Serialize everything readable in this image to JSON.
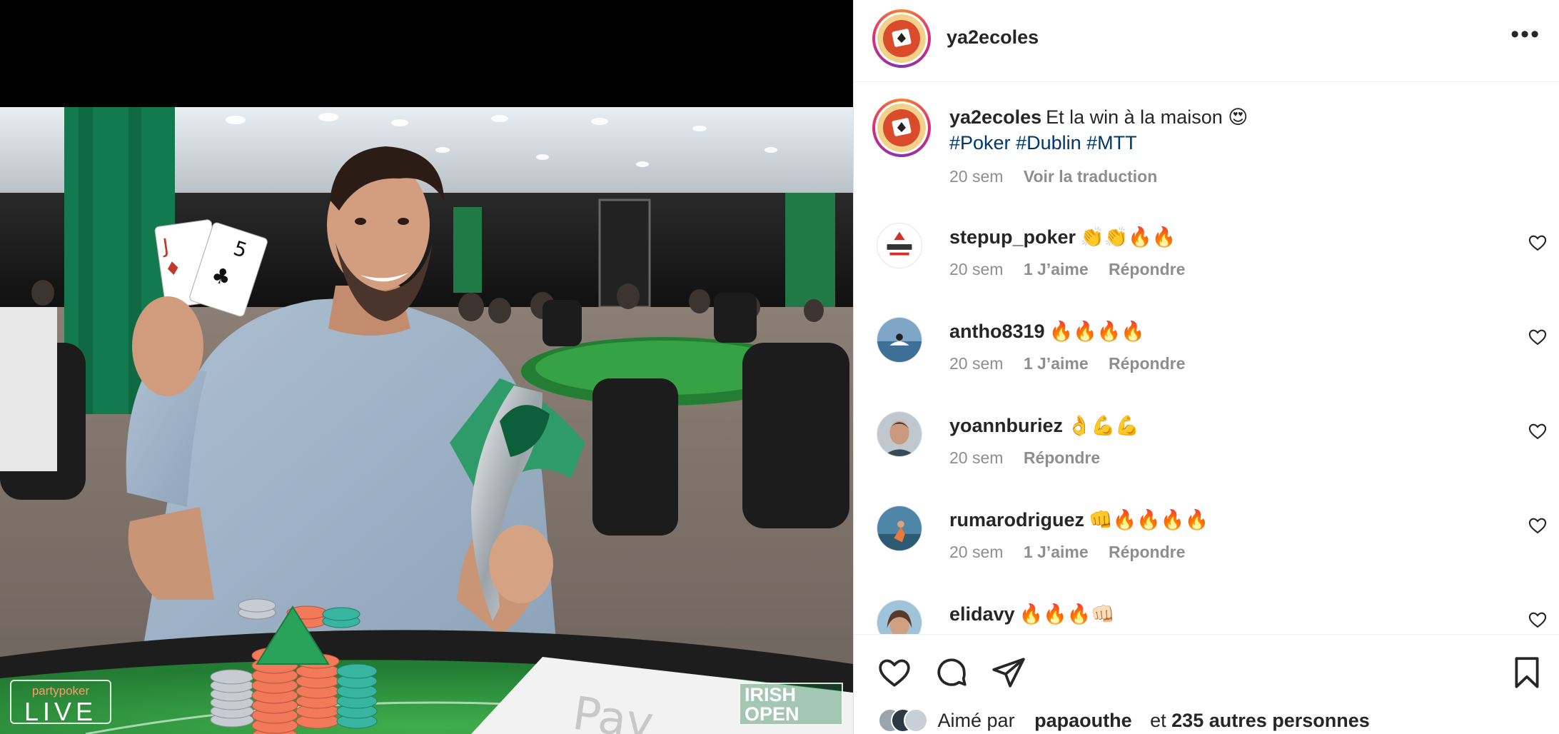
{
  "post": {
    "username": "ya2ecoles",
    "more_icon": "more-horizontal-icon"
  },
  "caption": {
    "username": "ya2ecoles",
    "text": "Et la win à la maison 😍",
    "hashtags": [
      "#Poker",
      "#Dublin",
      "#MTT"
    ],
    "time": "20 sem",
    "translate": "Voir la traduction"
  },
  "comments": [
    {
      "username": "stepup_poker",
      "text": "👏👏🔥🔥",
      "time": "20 sem",
      "likes": "1 J’aime",
      "reply": "Répondre"
    },
    {
      "username": "antho8319",
      "text": "🔥🔥🔥🔥",
      "time": "20 sem",
      "likes": "1 J’aime",
      "reply": "Répondre"
    },
    {
      "username": "yoannburiez",
      "text": "👌💪💪",
      "time": "20 sem",
      "likes": "",
      "reply": "Répondre"
    },
    {
      "username": "rumarodriguez",
      "text": "👊🔥🔥🔥🔥",
      "time": "20 sem",
      "likes": "1 J’aime",
      "reply": "Répondre"
    },
    {
      "username": "elidavy",
      "text": "🔥🔥🔥👊🏻",
      "time": "",
      "likes": "",
      "reply": ""
    }
  ],
  "image": {
    "watermark_left_top": "partypoker",
    "watermark_left_big": "LIVE",
    "watermark_right_line1": "IRISH",
    "watermark_right_line2": "OPEN",
    "card1_rank": "J",
    "card2_rank": "5",
    "card1_suit": "♦",
    "card2_suit": "♣"
  },
  "actions": {
    "like_icon": "heart-icon",
    "comment_icon": "comment-icon",
    "share_icon": "send-icon",
    "save_icon": "bookmark-icon"
  },
  "likes_line": {
    "prefix": "Aimé par",
    "user": "papaouthe",
    "middle": "et",
    "others": "235 autres personnes"
  },
  "colors": {
    "link": "#00376b",
    "muted": "#8e8e8e",
    "table_felt": "#2f9a3e"
  }
}
